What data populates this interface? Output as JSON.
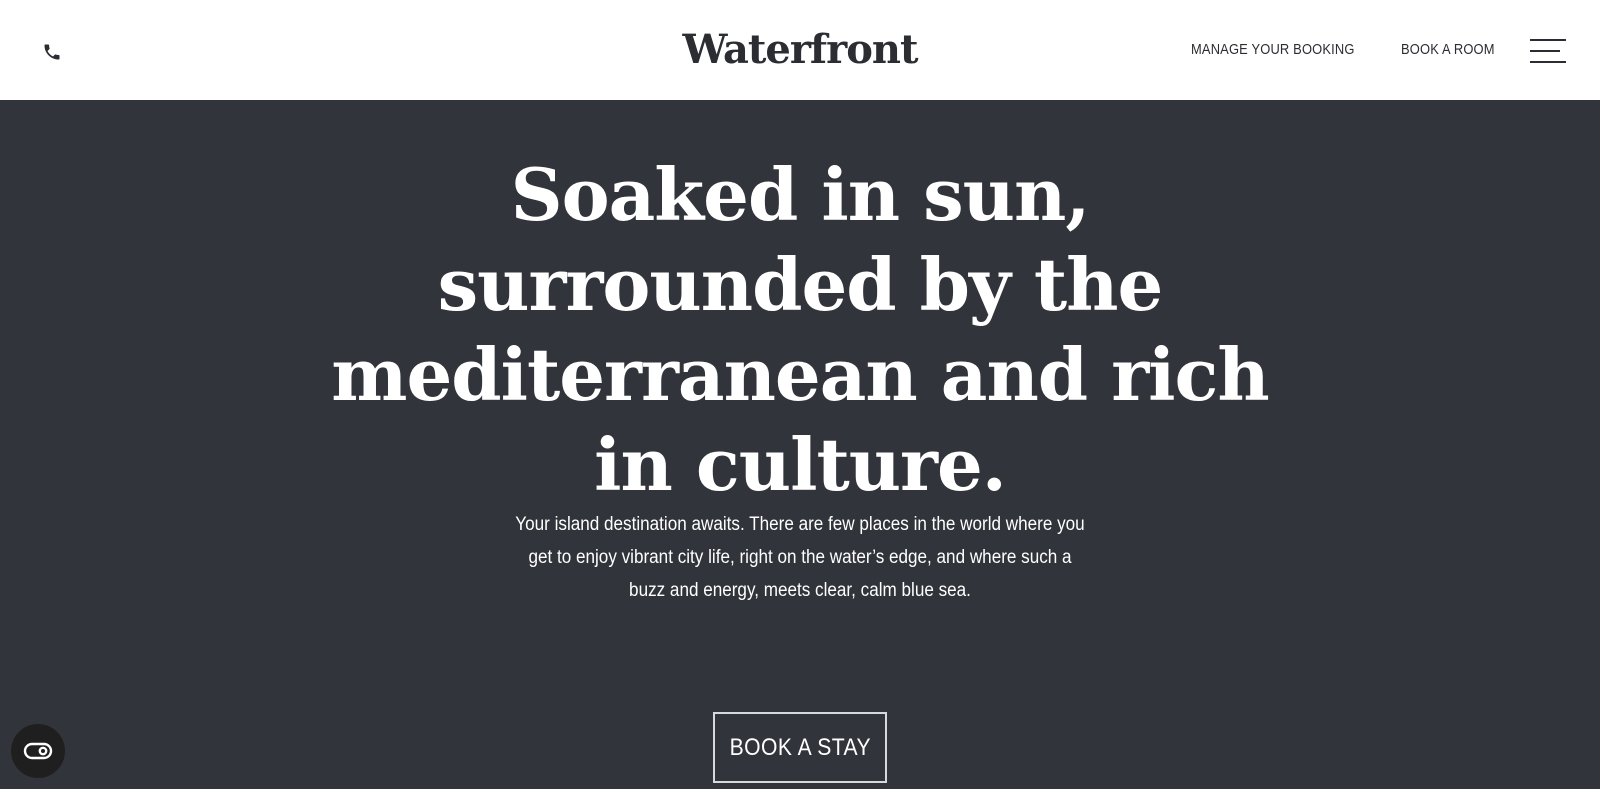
{
  "header": {
    "logo_text": "Waterfront",
    "phone_icon": "phone-icon",
    "nav": {
      "manage_booking": "MANAGE YOUR BOOKING",
      "book_room": "BOOK A ROOM"
    },
    "menu_icon": "hamburger-menu-icon"
  },
  "hero": {
    "title": "Soaked in sun, surrounded by the mediterranean and rich in culture.",
    "description": "Your island destination awaits. There are few places in the world where you get to enjoy vibrant city life, right on the water’s edge, and where such a buzz and energy, meets clear, calm blue sea.",
    "cta_label": "BOOK A STAY"
  },
  "accessibility": {
    "icon": "accessibility-toggle-icon"
  },
  "colors": {
    "header_bg": "#ffffff",
    "hero_bg": "#31343a",
    "text_dark": "#2b2d33",
    "text_light": "#ffffff",
    "button_border": "#d8d9dc"
  }
}
